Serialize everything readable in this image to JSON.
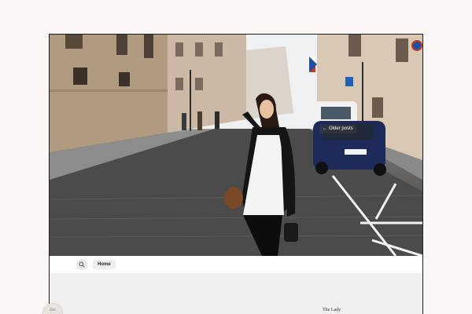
{
  "overlay": {
    "older_posts_label": "Older posts",
    "arrow_glyph": "←"
  },
  "toolbar": {
    "search_icon": "search-icon",
    "home_label": "Home"
  },
  "post": {
    "title": "The Lady",
    "date_label": "Dec"
  },
  "colors": {
    "page_bg": "#fbf7f6",
    "frame_border": "#1b1b1b",
    "toolbar_bg": "#ffffff",
    "content_bg": "#efefee"
  }
}
